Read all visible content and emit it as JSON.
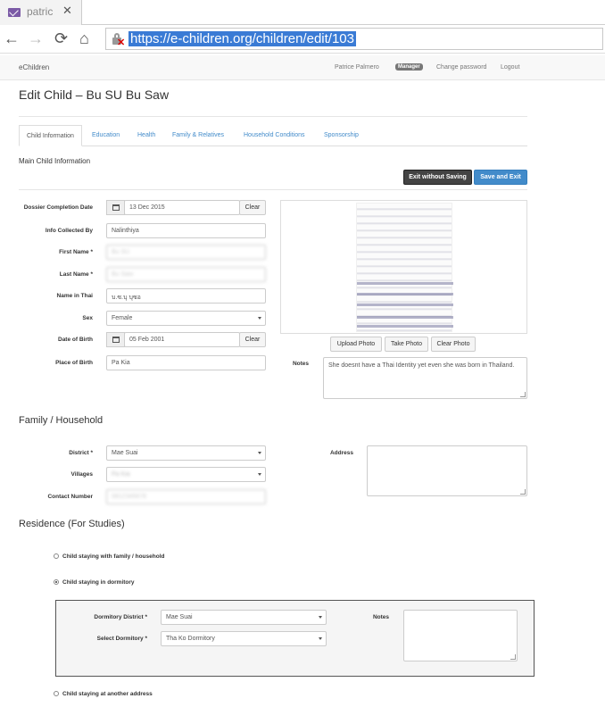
{
  "browser": {
    "tab_title": "patric",
    "url": "https://e-children.org/children/edit/103"
  },
  "nav": {
    "brand": "eChildren",
    "user": "Patrice Palmero",
    "role_badge": "Manager",
    "change_password": "Change password",
    "logout": "Logout"
  },
  "page": {
    "title": "Edit Child – Bu SU Bu Saw"
  },
  "tabs": [
    "Child Information",
    "Education",
    "Health",
    "Family & Relatives",
    "Household Conditions",
    "Sponsorship"
  ],
  "main_info": {
    "heading": "Main Child Information",
    "exit_without_saving": "Exit without Saving",
    "save_and_exit": "Save and Exit",
    "fields": {
      "dossier_label": "Dossier Completion Date",
      "dossier_value": "13 Dec 2015",
      "clear": "Clear",
      "info_collected_label": "Info Collected By",
      "info_collected_value": "Nalinthiya",
      "first_name_label": "First Name *",
      "first_name_value": "Bu SU",
      "last_name_label": "Last Name *",
      "last_name_value": "Bu Saw",
      "name_thai_label": "Name in Thai",
      "name_thai_value": "บ.ซ.บุ  บุซอ",
      "sex_label": "Sex",
      "sex_value": "Female",
      "dob_label": "Date of Birth",
      "dob_value": "05 Feb 2001",
      "pob_label": "Place of Birth",
      "pob_value": "Pa Kia"
    },
    "photo_buttons": {
      "upload": "Upload Photo",
      "take": "Take Photo",
      "clear": "Clear Photo"
    },
    "notes_label": "Notes",
    "notes_value": "She doesnt have a Thai Identity yet even she was born in Thailand."
  },
  "family": {
    "heading": "Family / Household",
    "district_label": "District *",
    "district_value": "Mae Suai",
    "villages_label": "Villages",
    "villages_value": "Pa Kia",
    "contact_label": "Contact Number",
    "contact_value": "0812345678",
    "address_label": "Address"
  },
  "residence": {
    "heading": "Residence (For Studies)",
    "opt_family": "Child staying with family / household",
    "opt_dormitory": "Child staying in dormitory",
    "opt_other": "Child staying at another address",
    "dorm_district_label": "Dormitory District *",
    "dorm_district_value": "Mae Suai",
    "select_dorm_label": "Select Dormitory *",
    "select_dorm_value": "Tha Ko Dormitory",
    "notes_label": "Notes"
  }
}
